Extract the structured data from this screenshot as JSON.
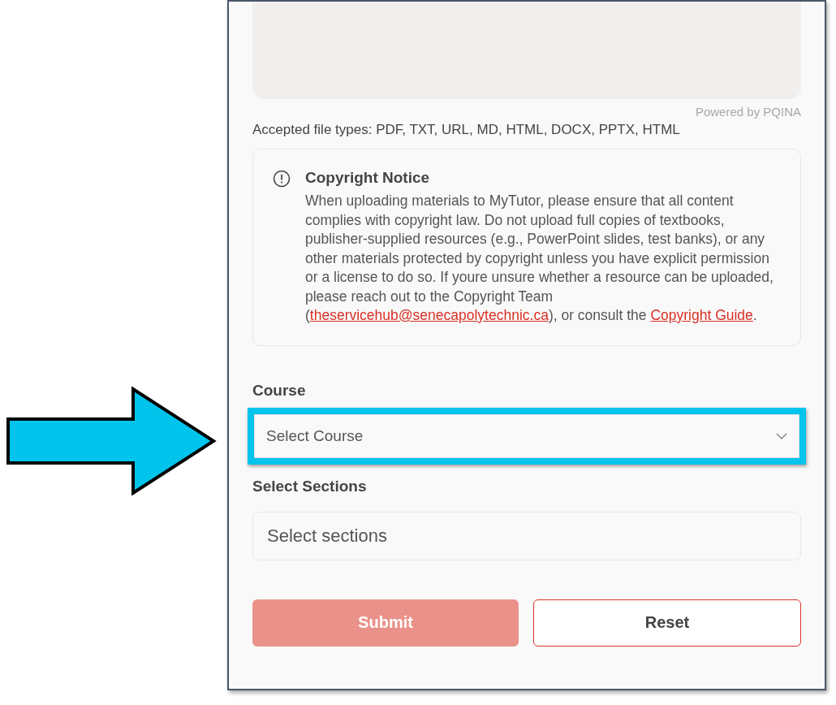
{
  "upload": {
    "powered_by": "Powered by PQINA",
    "accepted_types": "Accepted file types: PDF, TXT, URL, MD, HTML, DOCX, PPTX, HTML"
  },
  "notice": {
    "title": "Copyright Notice",
    "text_before": "When uploading materials to MyTutor, please ensure that all content complies with copyright law. Do not upload full copies of textbooks, publisher-supplied resources (e.g., PowerPoint slides, test banks), or any other materials protected by copyright unless you have explicit permission or a license to do so. If youre unsure whether a resource can be uploaded, please reach out to the Copyright Team (",
    "email_link": "theservicehub@senecapolytechnic.ca",
    "text_middle": "), or consult the ",
    "guide_link": "Copyright Guide",
    "text_after": "."
  },
  "course": {
    "label": "Course",
    "placeholder": "Select Course",
    "highlighted": true
  },
  "sections": {
    "label": "Select Sections",
    "placeholder": "Select sections"
  },
  "buttons": [
    {
      "label": "Submit",
      "kind": "primary",
      "disabled": true
    },
    {
      "label": "Reset",
      "kind": "outline",
      "disabled": false
    }
  ]
}
